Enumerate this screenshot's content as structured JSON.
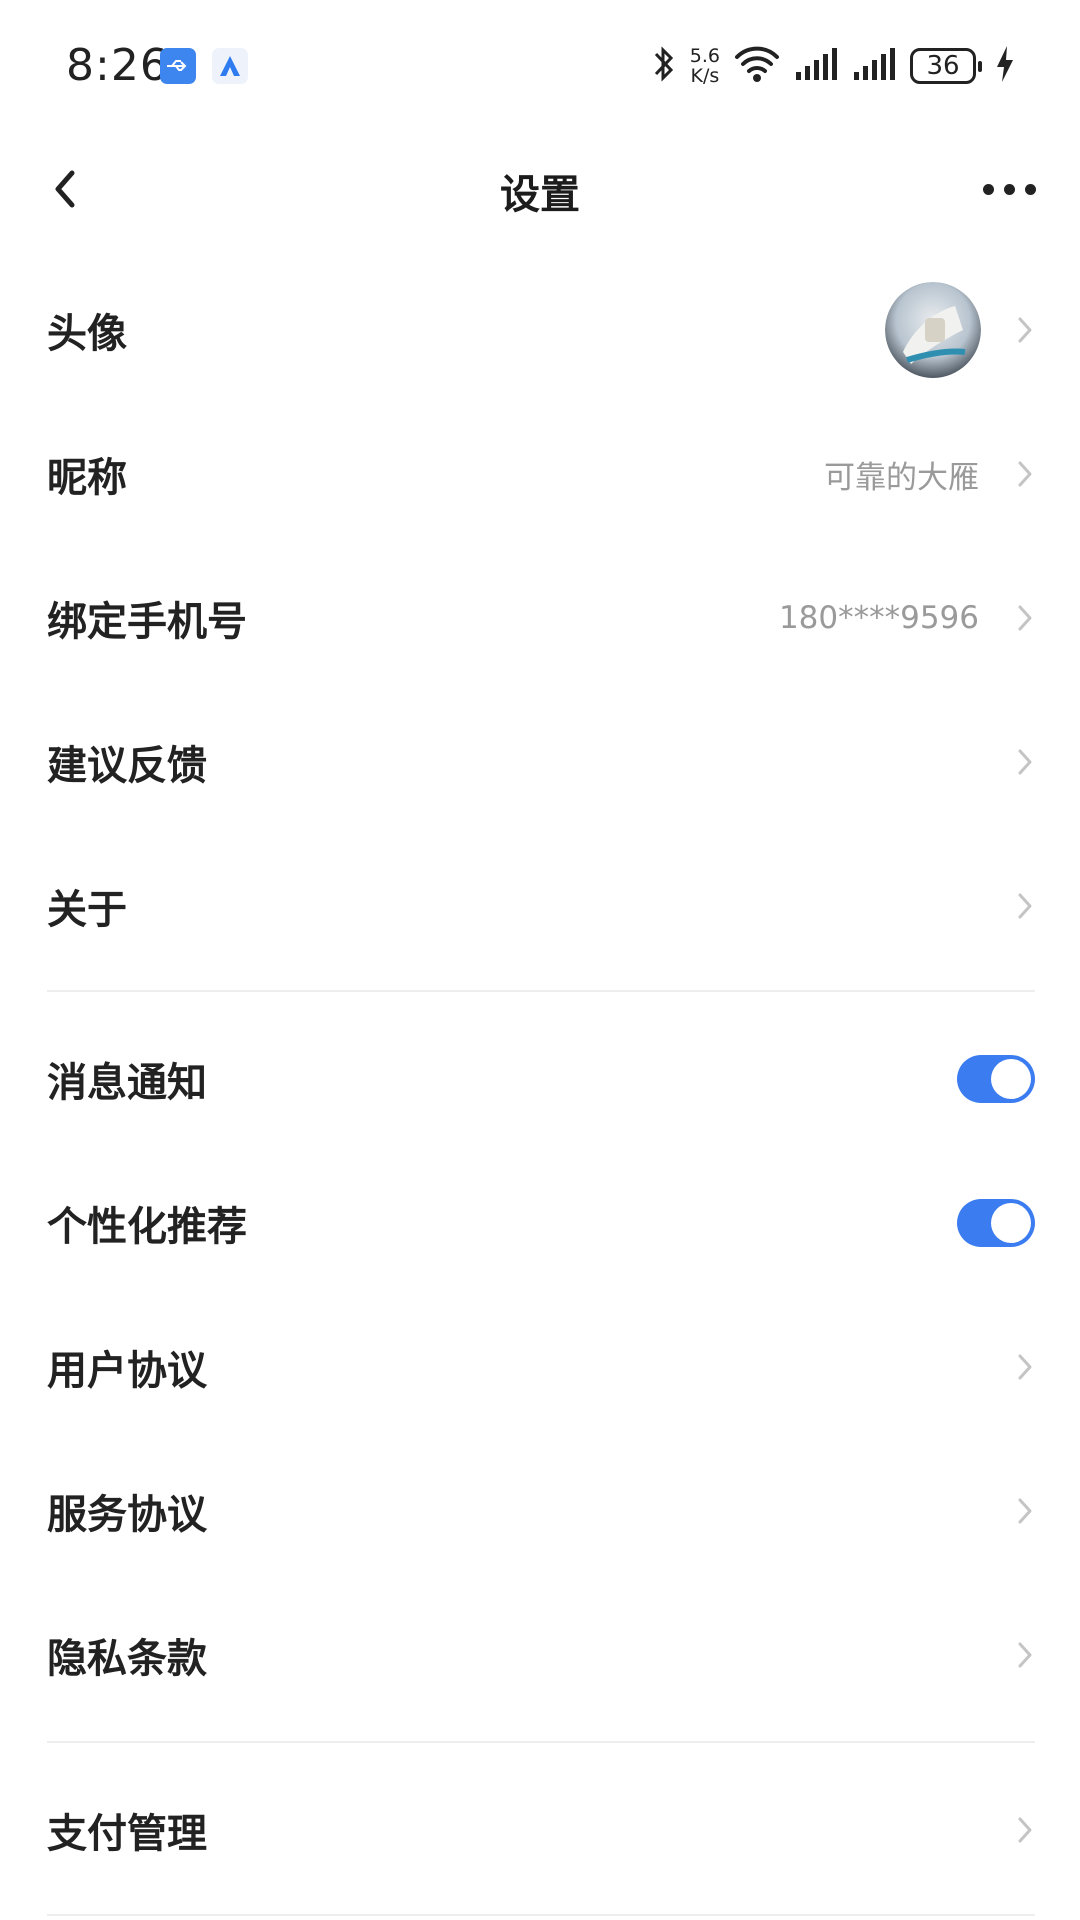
{
  "status_bar": {
    "time": "8:26",
    "net_speed_value": "5.6",
    "net_speed_unit": "K/s",
    "battery": "36",
    "icons": [
      "usb-icon",
      "app-notification-icon",
      "bluetooth-icon",
      "wifi-icon",
      "signal-icon",
      "signal-icon",
      "battery-icon",
      "charging-icon"
    ]
  },
  "header": {
    "title": "设置",
    "back_icon": "chevron-left-icon",
    "more_icon": "more-dots-icon"
  },
  "rows": {
    "avatar": {
      "label": "头像"
    },
    "nickname": {
      "label": "昵称",
      "value": "可靠的大雁"
    },
    "phone": {
      "label": "绑定手机号",
      "value": "180****9596"
    },
    "feedback": {
      "label": "建议反馈"
    },
    "about": {
      "label": "关于"
    },
    "notifications": {
      "label": "消息通知",
      "enabled": true
    },
    "personalized": {
      "label": "个性化推荐",
      "enabled": true
    },
    "user_agreement": {
      "label": "用户协议"
    },
    "service_agreement": {
      "label": "服务协议"
    },
    "privacy": {
      "label": "隐私条款"
    },
    "payment": {
      "label": "支付管理"
    }
  },
  "colors": {
    "accent": "#3b7cf0",
    "value_text": "#9a9a9a",
    "label_text": "#222222",
    "chevron": "#c4c4c4"
  }
}
